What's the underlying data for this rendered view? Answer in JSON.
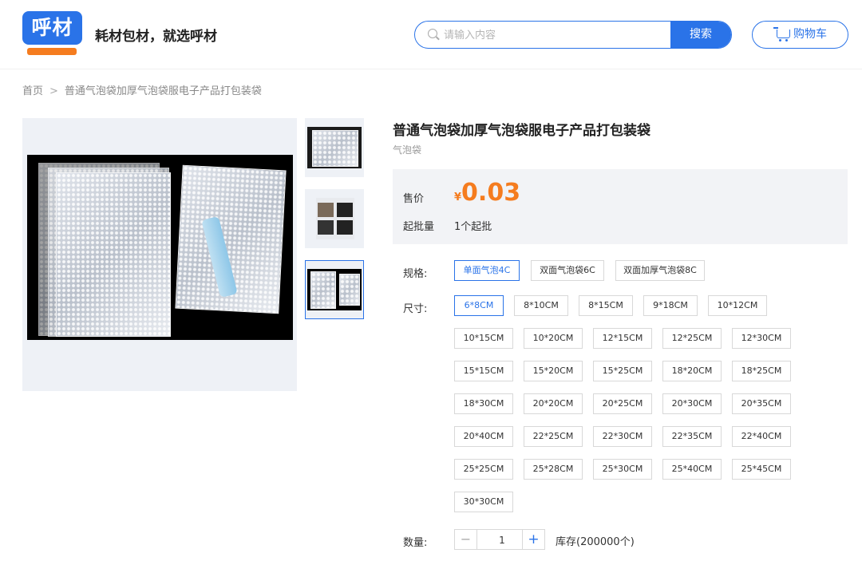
{
  "header": {
    "logo_text": "呼材",
    "slogan": "耗材包材，就选呼材",
    "search_placeholder": "请输入内容",
    "search_button": "搜索",
    "cart_label": "购物车",
    "accent_color": "#2a73e8",
    "brand_orange": "#f57c1f"
  },
  "breadcrumb": {
    "home": "首页",
    "separator": ">",
    "current": "普通气泡袋加厚气泡袋服电子产品打包装袋"
  },
  "gallery": {
    "thumb_count": 3,
    "active_thumb_index": 2
  },
  "product": {
    "title": "普通气泡袋加厚气泡袋服电子产品打包装袋",
    "category": "气泡袋",
    "price_label": "售价",
    "currency": "¥",
    "price": "0.03",
    "moq_label": "起批量",
    "moq_value": "1个起批"
  },
  "spec": {
    "label": "规格:",
    "options": [
      "单面气泡4C",
      "双面气泡袋6C",
      "双面加厚气泡袋8C"
    ],
    "selected": "单面气泡4C"
  },
  "size": {
    "label": "尺寸:",
    "options": [
      "6*8CM",
      "8*10CM",
      "8*15CM",
      "9*18CM",
      "10*12CM",
      "10*15CM",
      "10*20CM",
      "12*15CM",
      "12*25CM",
      "12*30CM",
      "15*15CM",
      "15*20CM",
      "15*25CM",
      "18*20CM",
      "18*25CM",
      "18*30CM",
      "20*20CM",
      "20*25CM",
      "20*30CM",
      "20*35CM",
      "20*40CM",
      "22*25CM",
      "22*30CM",
      "22*35CM",
      "22*40CM",
      "25*25CM",
      "25*28CM",
      "25*30CM",
      "25*40CM",
      "25*45CM",
      "30*30CM"
    ],
    "selected": "6*8CM"
  },
  "quantity": {
    "label": "数量:",
    "minus": "−",
    "value": "1",
    "plus": "+",
    "stock": "库存(200000个)"
  }
}
